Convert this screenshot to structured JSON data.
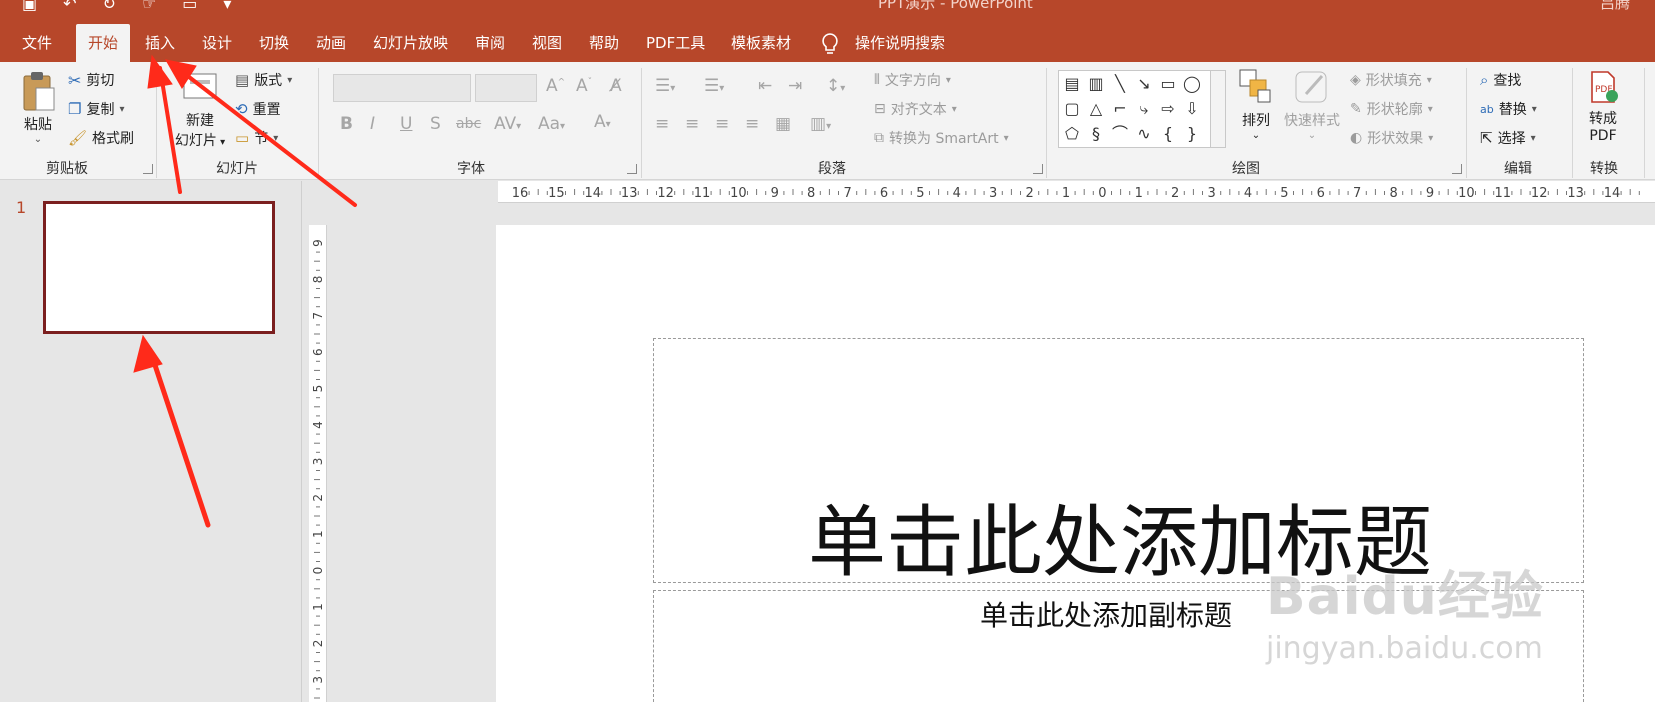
{
  "window": {
    "title": "PPT演示 - PowerPoint",
    "user": "吕腾",
    "accent_color": "#b7472a"
  },
  "quick_access": [
    "save-icon",
    "undo-icon",
    "redo-icon",
    "touch-mode-icon",
    "present-icon",
    "customize-icon"
  ],
  "tabs": [
    {
      "label": "文件"
    },
    {
      "label": "开始"
    },
    {
      "label": "插入"
    },
    {
      "label": "设计"
    },
    {
      "label": "切换"
    },
    {
      "label": "动画"
    },
    {
      "label": "幻灯片放映"
    },
    {
      "label": "审阅"
    },
    {
      "label": "视图"
    },
    {
      "label": "帮助"
    },
    {
      "label": "PDF工具"
    },
    {
      "label": "模板素材"
    }
  ],
  "tell_me": "操作说明搜索",
  "ribbon": {
    "clipboard": {
      "label": "剪贴板",
      "paste": "粘贴",
      "cut": "剪切",
      "copy": "复制",
      "format_painter": "格式刷"
    },
    "slides": {
      "label": "幻灯片",
      "new_slide_line1": "新建",
      "new_slide_line2": "幻灯片",
      "layout": "版式",
      "reset": "重置",
      "section": "节"
    },
    "font": {
      "label": "字体"
    },
    "paragraph": {
      "label": "段落",
      "text_direction": "文字方向",
      "align_text": "对齐文本",
      "smartart": "转换为 SmartArt"
    },
    "drawing": {
      "label": "绘图",
      "arrange": "排列",
      "quick_styles": "快速样式",
      "shape_fill": "形状填充",
      "shape_outline": "形状轮廓",
      "shape_effects": "形状效果"
    },
    "editing": {
      "label": "编辑",
      "find": "查找",
      "replace": "替换",
      "select": "选择"
    },
    "convert": {
      "label": "转换",
      "to_pdf_line1": "转成",
      "to_pdf_line2": "PDF"
    }
  },
  "thumbnails": [
    {
      "number": "1"
    }
  ],
  "slide": {
    "title_placeholder": "单击此处添加标题",
    "subtitle_placeholder": "单击此处添加副标题"
  },
  "watermark": {
    "line1": "Baidu经验",
    "line2": "jingyan.baidu.com"
  },
  "rulers": {
    "horizontal": [
      "16",
      "15",
      "14",
      "13",
      "12",
      "11",
      "10",
      "9",
      "8",
      "7",
      "6",
      "5",
      "4",
      "3",
      "2",
      "1",
      "0",
      "1",
      "2",
      "3",
      "4",
      "5",
      "6",
      "7",
      "8",
      "9",
      "10",
      "11",
      "12",
      "13",
      "14"
    ],
    "vertical": [
      "9",
      "8",
      "7",
      "6",
      "5",
      "4",
      "3",
      "2",
      "1",
      "0",
      "1",
      "2",
      "3"
    ]
  }
}
